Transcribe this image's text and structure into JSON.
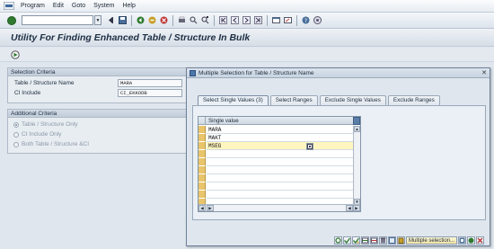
{
  "menu": {
    "items": [
      "Program",
      "Edit",
      "Goto",
      "System",
      "Help"
    ]
  },
  "title": "Utility For Finding Enhanced Table / Structure In Bulk",
  "selection": {
    "header": "Selection Criteria",
    "rows": [
      {
        "label": "Table / Structure Name",
        "value": "MARA",
        "to": "to"
      },
      {
        "label": "CI Include",
        "value": "CI_EKKODB",
        "to": "to"
      }
    ]
  },
  "additional": {
    "header": "Additional Criteria",
    "options": [
      {
        "label": "Table / Structure Only",
        "selected": true
      },
      {
        "label": "CI Include Only",
        "selected": false
      },
      {
        "label": "Both Table / Structure &CI",
        "selected": false
      }
    ]
  },
  "dialog": {
    "title": "Multiple Selection for Table / Structure Name",
    "tabs": [
      "Select Single Values (3)",
      "Select Ranges",
      "Exclude Single Values",
      "Exclude Ranges"
    ],
    "active_tab": 0,
    "column_header": "Single value",
    "values": [
      "MARA",
      "MAKT",
      "MSEG",
      "",
      "",
      "",
      "",
      "",
      "",
      ""
    ],
    "multiple_selection_label": "Multiple selection..."
  },
  "colors": {
    "background": "#dfe6ee",
    "row_selector": "#e9c46a",
    "accent": "#4c78aa"
  }
}
